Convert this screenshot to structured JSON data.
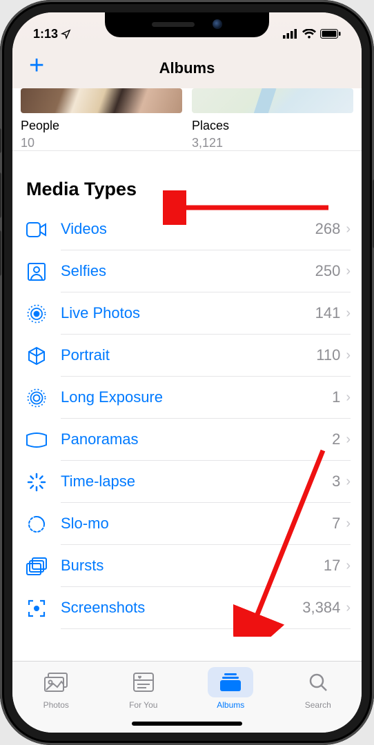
{
  "status": {
    "time": "1:13"
  },
  "header": {
    "title": "Albums"
  },
  "albums_strip": [
    {
      "name": "People",
      "count": "10",
      "thumb": "people"
    },
    {
      "name": "Places",
      "count": "3,121",
      "thumb": "places"
    }
  ],
  "section_title": "Media Types",
  "media_types": [
    {
      "icon": "video-icon",
      "label": "Videos",
      "count": "268"
    },
    {
      "icon": "selfies-icon",
      "label": "Selfies",
      "count": "250"
    },
    {
      "icon": "live-photos-icon",
      "label": "Live Photos",
      "count": "141"
    },
    {
      "icon": "portrait-icon",
      "label": "Portrait",
      "count": "110"
    },
    {
      "icon": "long-exposure-icon",
      "label": "Long Exposure",
      "count": "1"
    },
    {
      "icon": "panoramas-icon",
      "label": "Panoramas",
      "count": "2"
    },
    {
      "icon": "time-lapse-icon",
      "label": "Time-lapse",
      "count": "3"
    },
    {
      "icon": "slo-mo-icon",
      "label": "Slo-mo",
      "count": "7"
    },
    {
      "icon": "bursts-icon",
      "label": "Bursts",
      "count": "17"
    },
    {
      "icon": "screenshots-icon",
      "label": "Screenshots",
      "count": "3,384"
    }
  ],
  "tabs": [
    {
      "icon": "photos-tab-icon",
      "label": "Photos",
      "active": false
    },
    {
      "icon": "for-you-tab-icon",
      "label": "For You",
      "active": false
    },
    {
      "icon": "albums-tab-icon",
      "label": "Albums",
      "active": true
    },
    {
      "icon": "search-tab-icon",
      "label": "Search",
      "active": false
    }
  ]
}
